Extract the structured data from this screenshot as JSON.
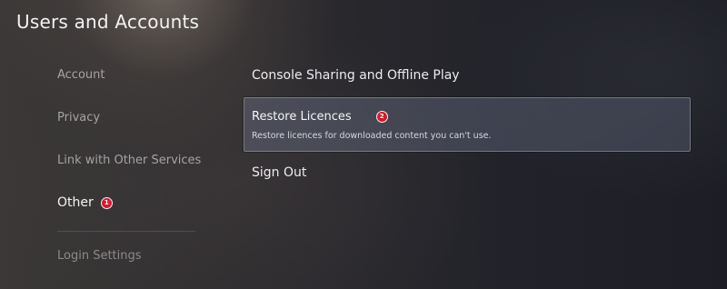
{
  "header": {
    "title": "Users and Accounts"
  },
  "sidebar": {
    "items": [
      {
        "label": "Account"
      },
      {
        "label": "Privacy"
      },
      {
        "label": "Link with Other Services"
      },
      {
        "label": "Other",
        "badge": "1",
        "selected": true
      },
      {
        "label": "Login Settings"
      }
    ]
  },
  "main": {
    "items": [
      {
        "label": "Console Sharing and Offline Play"
      },
      {
        "label": "Restore Licences",
        "badge": "2",
        "description": "Restore licences for downloaded content you can't use.",
        "focused": true
      },
      {
        "label": "Sign Out"
      }
    ]
  },
  "colors": {
    "badge": "#d7192a",
    "focus_background": "#5c6276"
  }
}
